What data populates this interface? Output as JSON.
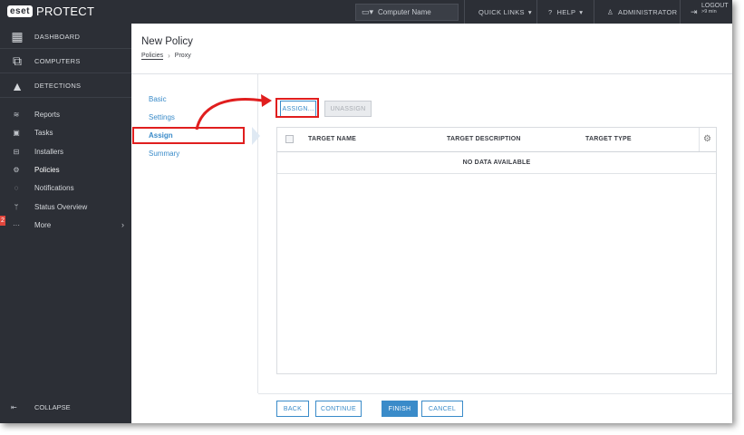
{
  "brand": {
    "badge": "eset",
    "product": "PROTECT"
  },
  "topbar": {
    "search_placeholder": "Computer Name",
    "quick_links": "QUICK LINKS",
    "help": "HELP",
    "user": "ADMINISTRATOR",
    "logout": "LOGOUT",
    "logout_time": ">9 min"
  },
  "sidebar": {
    "main": [
      {
        "label": "DASHBOARD",
        "icon": "dashboard-icon"
      },
      {
        "label": "COMPUTERS",
        "icon": "computers-icon"
      },
      {
        "label": "DETECTIONS",
        "icon": "warning-icon"
      }
    ],
    "items": [
      {
        "label": "Reports"
      },
      {
        "label": "Tasks"
      },
      {
        "label": "Installers"
      },
      {
        "label": "Policies"
      },
      {
        "label": "Notifications"
      },
      {
        "label": "Status Overview"
      },
      {
        "label": "More"
      }
    ],
    "badge": "2",
    "collapse": "COLLAPSE"
  },
  "header": {
    "title": "New Policy",
    "breadcrumb": [
      "Policies",
      "Proxy"
    ]
  },
  "steps": [
    {
      "label": "Basic"
    },
    {
      "label": "Settings"
    },
    {
      "label": "Assign"
    },
    {
      "label": "Summary"
    }
  ],
  "toolbar": {
    "assign": "ASSIGN...",
    "unassign": "UNASSIGN"
  },
  "table": {
    "columns": [
      "TARGET NAME",
      "TARGET DESCRIPTION",
      "TARGET TYPE"
    ],
    "empty": "NO DATA AVAILABLE"
  },
  "footer": {
    "back": "BACK",
    "continue": "CONTINUE",
    "finish": "FINISH",
    "cancel": "CANCEL"
  },
  "colors": {
    "accent": "#3a8bc9",
    "annotation": "#e01e1e",
    "sidebar_bg": "#2c2f36"
  }
}
